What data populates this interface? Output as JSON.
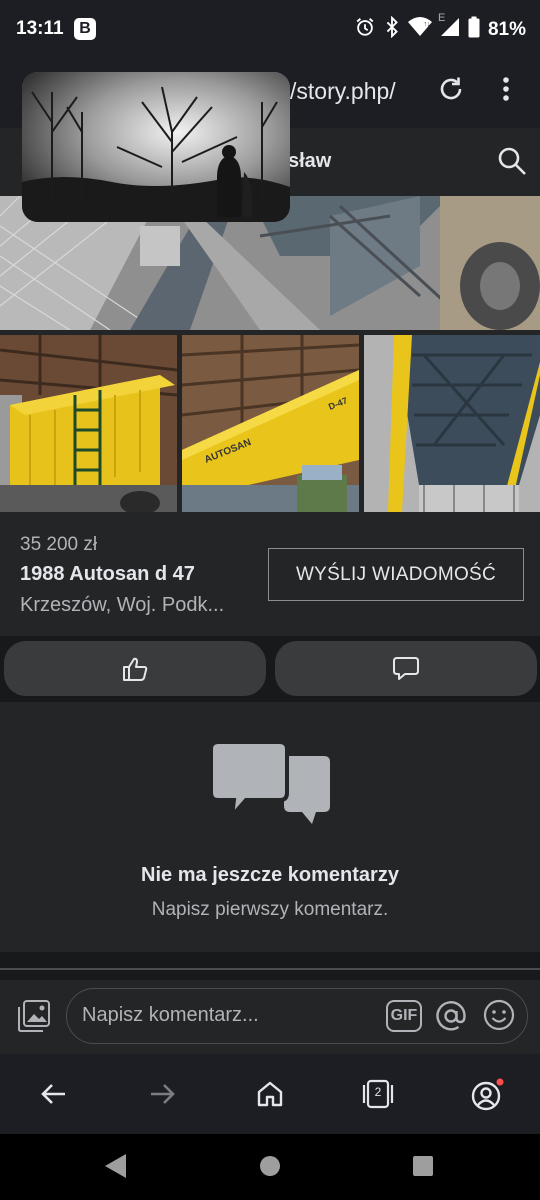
{
  "status_bar": {
    "time": "13:11",
    "app_badge": "B",
    "signal_label": "E",
    "battery": "81%"
  },
  "browser": {
    "url": "/story.php/"
  },
  "header": {
    "name_fragment": "sław"
  },
  "listing": {
    "price": "35 200 zł",
    "title": "1988 Autosan d 47",
    "location": "Krzeszów, Woj. Podk...",
    "send_button": "WYŚLIJ WIADOMOŚĆ"
  },
  "photos": {
    "brand_text": "AUTOSAN",
    "model_text": "D-47"
  },
  "comments": {
    "empty_title": "Nie ma jeszcze komentarzy",
    "empty_subtitle": "Napisz pierwszy komentarz."
  },
  "composer": {
    "placeholder": "Napisz komentarz...",
    "gif_label": "GIF"
  },
  "browser_nav": {
    "tab_count": "2"
  },
  "colors": {
    "background": "#242526",
    "pill": "#3a3b3c",
    "text": "#e4e6eb",
    "muted": "#b0b3b8",
    "yellow": "#e6c419",
    "notification_dot": "#ff4d4d"
  },
  "icons": [
    "alarm-icon",
    "bluetooth-icon",
    "wifi-icon",
    "signal-icon",
    "battery-icon",
    "reload-icon",
    "menu-icon",
    "search-icon",
    "like-icon",
    "comment-icon",
    "chat-bubbles-icon",
    "photo-icon",
    "mention-icon",
    "emoji-icon",
    "back-icon",
    "forward-icon",
    "home-icon",
    "tabs-icon",
    "account-icon"
  ]
}
